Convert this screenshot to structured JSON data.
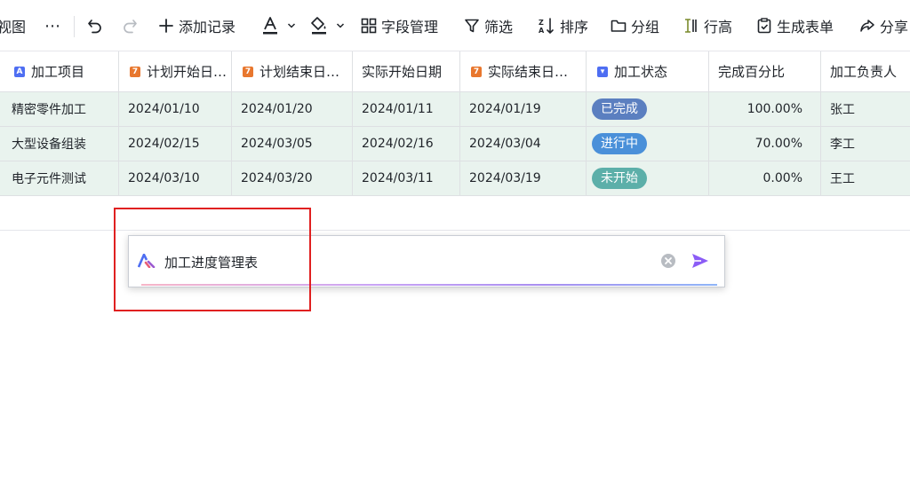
{
  "toolbar": {
    "view_label": "视图",
    "more_label": "⋯",
    "add_record_label": "添加记录",
    "field_manage_label": "字段管理",
    "filter_label": "筛选",
    "sort_label": "排序",
    "group_label": "分组",
    "row_height_label": "行高",
    "generate_form_label": "生成表单",
    "share_label": "分享"
  },
  "columns": [
    {
      "label": "加工项目",
      "icon": "text-field-icon"
    },
    {
      "label": "计划开始日…",
      "icon": "date-field-icon"
    },
    {
      "label": "计划结束日…",
      "icon": "date-field-icon"
    },
    {
      "label": "实际开始日期",
      "icon": ""
    },
    {
      "label": "实际结束日…",
      "icon": "date-field-icon"
    },
    {
      "label": "加工状态",
      "icon": "select-field-icon"
    },
    {
      "label": "完成百分比",
      "icon": ""
    },
    {
      "label": "加工负责人",
      "icon": ""
    }
  ],
  "rows": [
    {
      "project": "精密零件加工",
      "plan_start": "2024/01/10",
      "plan_end": "2024/01/20",
      "actual_start": "2024/01/11",
      "actual_end": "2024/01/19",
      "status": "已完成",
      "status_color": "#5b7fc0",
      "percent": "100.00%",
      "owner": "张工"
    },
    {
      "project": "大型设备组装",
      "plan_start": "2024/02/15",
      "plan_end": "2024/03/05",
      "actual_start": "2024/02/16",
      "actual_end": "2024/03/04",
      "status": "进行中",
      "status_color": "#4a90d9",
      "percent": "70.00%",
      "owner": "李工"
    },
    {
      "project": "电子元件测试",
      "plan_start": "2024/03/10",
      "plan_end": "2024/03/20",
      "actual_start": "2024/03/11",
      "actual_end": "2024/03/19",
      "status": "未开始",
      "status_color": "#5cafa9",
      "percent": "0.00%",
      "owner": "王工"
    }
  ],
  "prompt": {
    "value": "加工进度管理表"
  },
  "colors": {
    "row_bg": "#e9f3ee",
    "send_accent": "#8b5cf6",
    "highlight_border": "#e02020"
  }
}
